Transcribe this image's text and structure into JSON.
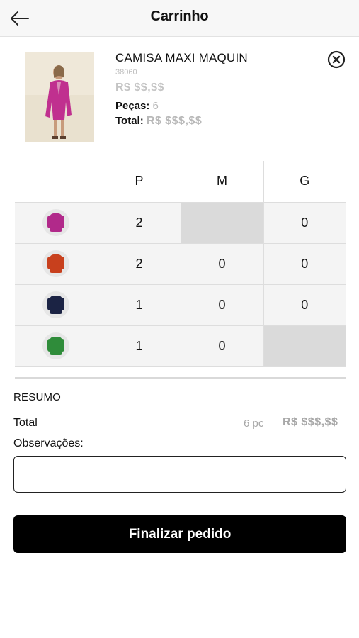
{
  "header": {
    "title": "Carrinho",
    "back_icon": "arrow-left-icon"
  },
  "product": {
    "name": "CAMISA MAXI MAQUIN",
    "ref": "38060",
    "price": "R$ $$,$$",
    "pieces_label": "Peças:",
    "pieces_value": "6",
    "total_label": "Total:",
    "total_value": "R$ $$$,$$",
    "remove_icon": "close-circle-icon",
    "photo_colors": {
      "background": "#e9e1cf",
      "garment": "#c0308f"
    }
  },
  "grid": {
    "sizes": [
      "P",
      "M",
      "G"
    ],
    "rows": [
      {
        "color_name": "magenta",
        "swatch": "#b1298a",
        "cells": [
          "2",
          null,
          "0"
        ]
      },
      {
        "color_name": "orange",
        "swatch": "#c8401d",
        "cells": [
          "2",
          "0",
          "0"
        ]
      },
      {
        "color_name": "navy",
        "swatch": "#1b2344",
        "cells": [
          "1",
          "0",
          "0"
        ]
      },
      {
        "color_name": "green",
        "swatch": "#2f8c3a",
        "cells": [
          "1",
          "0",
          null
        ]
      }
    ]
  },
  "summary": {
    "title": "RESUMO",
    "total_label": "Total",
    "total_pieces": "6 pc",
    "total_price": "R$ $$$,$$",
    "observations_label": "Observações:",
    "observations_value": ""
  },
  "actions": {
    "submit_label": "Finalizar pedido"
  }
}
